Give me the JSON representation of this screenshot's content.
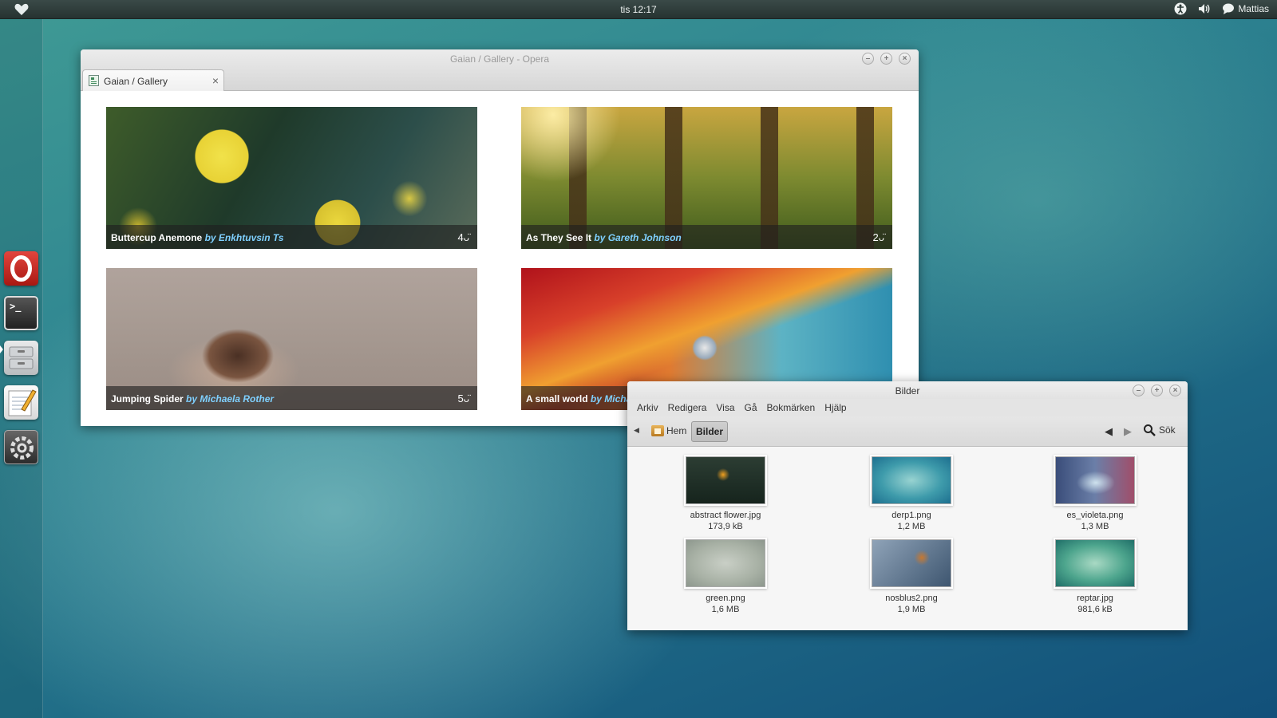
{
  "top_panel": {
    "clock": "tis 12:17",
    "user": "Mattias",
    "icons": [
      "heart-icon",
      "accessibility-icon",
      "volume-icon",
      "chat-icon"
    ]
  },
  "dock": {
    "items": [
      "opera-icon",
      "terminal-icon",
      "file-cabinet-icon",
      "text-editor-icon",
      "settings-icon"
    ],
    "terminal_glyph": ">_"
  },
  "opera": {
    "window_title": "Gaian / Gallery - Opera",
    "tab_label": "Gaian / Gallery",
    "tab_close": "×",
    "gallery": [
      {
        "title": "Buttercup Anemone",
        "author": "by Enkhtuvsin Ts",
        "likes": "4"
      },
      {
        "title": "As They See It",
        "author": "by Gareth Johnson",
        "likes": "2"
      },
      {
        "title": "Jumping Spider",
        "author": "by Michaela Rother",
        "likes": "5"
      },
      {
        "title": "A small world",
        "author": "by Michaela Rother",
        "likes": ""
      }
    ]
  },
  "file_manager": {
    "window_title": "Bilder",
    "menu": [
      "Arkiv",
      "Redigera",
      "Visa",
      "Gå",
      "Bokmärken",
      "Hjälp"
    ],
    "breadcrumb_home": "Hem",
    "breadcrumb_current": "Bilder",
    "search_label": "Sök",
    "files": [
      {
        "name": "abstract flower.jpg",
        "size": "173,9 kB"
      },
      {
        "name": "derp1.png",
        "size": "1,2 MB"
      },
      {
        "name": "es_violeta.png",
        "size": "1,3 MB"
      },
      {
        "name": "green.png",
        "size": "1,6 MB"
      },
      {
        "name": "nosblus2.png",
        "size": "1,9 MB"
      },
      {
        "name": "reptar.jpg",
        "size": "981,6 kB"
      }
    ]
  },
  "colors": {
    "accent_link": "#7fd0ff",
    "panel": "#2f3c3a",
    "desktop": "#2f8591"
  }
}
